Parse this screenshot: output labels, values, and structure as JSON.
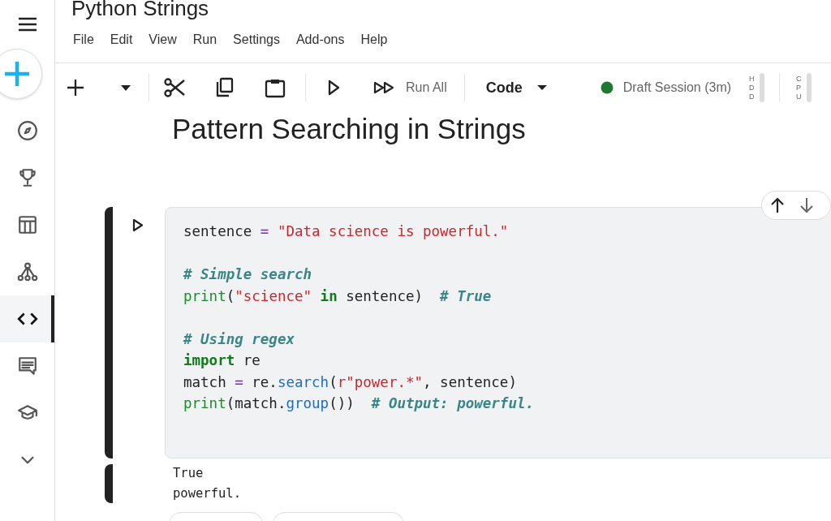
{
  "sidebar": {
    "items": [
      {
        "selected": false
      },
      {
        "selected": false
      },
      {
        "selected": false
      },
      {
        "selected": false
      },
      {
        "selected": true
      },
      {
        "selected": false
      },
      {
        "selected": false
      },
      {
        "selected": false
      }
    ]
  },
  "notebook": {
    "title": "Python Strings"
  },
  "menu": [
    "File",
    "Edit",
    "View",
    "Run",
    "Settings",
    "Add-ons",
    "Help"
  ],
  "toolbar": {
    "run_all": "Run All",
    "cell_type": "Code",
    "session": "Draft Session (3m)",
    "meters": [
      {
        "label": "HDD"
      },
      {
        "label": "CPU"
      }
    ]
  },
  "heading": "Pattern Searching in Strings",
  "cell": {
    "code": [
      {
        "kind": "code",
        "tokens": [
          {
            "kind": "plain",
            "text": "sentence "
          },
          {
            "kind": "op",
            "text": "= "
          },
          {
            "kind": "str",
            "text": "\"Data science is powerful.\""
          }
        ]
      },
      {
        "kind": "blank"
      },
      {
        "kind": "code",
        "tokens": [
          {
            "kind": "comment",
            "text": "# Simple search"
          }
        ]
      },
      {
        "kind": "code",
        "tokens": [
          {
            "kind": "builtin",
            "text": "print"
          },
          {
            "kind": "plain",
            "text": "("
          },
          {
            "kind": "str",
            "text": "\"science\" "
          },
          {
            "kind": "kw",
            "text": "in"
          },
          {
            "kind": "plain",
            "text": " sentence)  "
          },
          {
            "kind": "comment",
            "text": "# True"
          }
        ]
      },
      {
        "kind": "blank"
      },
      {
        "kind": "code",
        "tokens": [
          {
            "kind": "comment",
            "text": "# Using regex"
          }
        ]
      },
      {
        "kind": "code",
        "tokens": [
          {
            "kind": "kw",
            "text": "import"
          },
          {
            "kind": "plain",
            "text": " re"
          }
        ]
      },
      {
        "kind": "code",
        "tokens": [
          {
            "kind": "plain",
            "text": "match "
          },
          {
            "kind": "op",
            "text": "= "
          },
          {
            "kind": "plain",
            "text": "re."
          },
          {
            "kind": "func",
            "text": "search"
          },
          {
            "kind": "plain",
            "text": "("
          },
          {
            "kind": "str",
            "text": "r\"power.*\""
          },
          {
            "kind": "plain",
            "text": ", sentence)"
          }
        ]
      },
      {
        "kind": "code",
        "tokens": [
          {
            "kind": "builtin",
            "text": "print"
          },
          {
            "kind": "plain",
            "text": "(match."
          },
          {
            "kind": "func",
            "text": "group"
          },
          {
            "kind": "plain",
            "text": "())  "
          },
          {
            "kind": "comment",
            "text": "# Output: powerful."
          }
        ]
      }
    ],
    "output": [
      "True",
      "powerful."
    ]
  }
}
